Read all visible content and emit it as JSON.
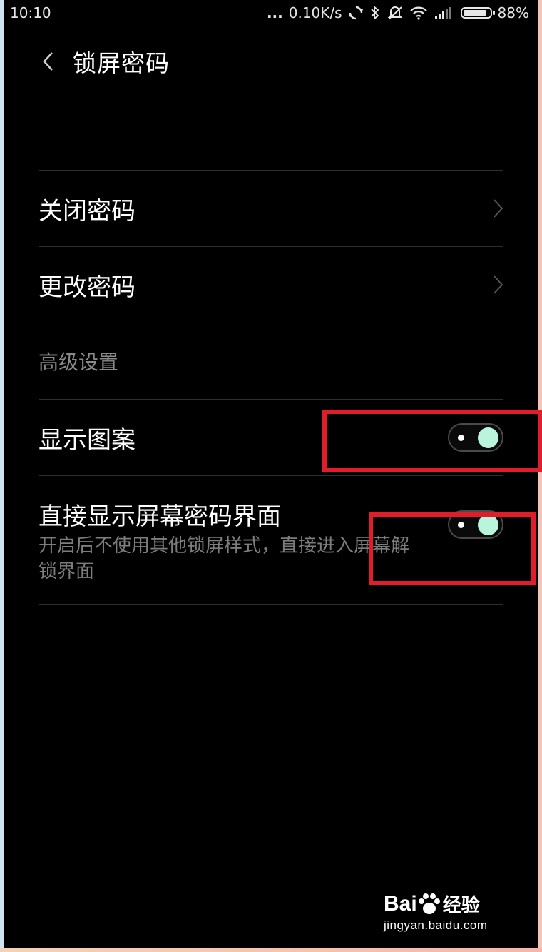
{
  "status_bar": {
    "time": "10:10",
    "dots": "...",
    "net_speed": "0.10K/s",
    "battery": "88%",
    "battery_level": 0.88,
    "icons": [
      "sync-icon",
      "bluetooth-icon",
      "mute-vibrate-icon",
      "wifi-icon",
      "signal-icon",
      "battery-icon"
    ]
  },
  "header": {
    "title": "锁屏密码",
    "back_icon": "chevron-left-icon"
  },
  "items": {
    "close_password": {
      "label": "关闭密码"
    },
    "change_password": {
      "label": "更改密码"
    }
  },
  "advanced": {
    "section_title": "高级设置",
    "show_pattern": {
      "label": "显示图案",
      "enabled": true
    },
    "direct_show": {
      "label": "直接显示屏幕密码界面",
      "description": "开启后不使用其他锁屏样式，直接进入屏幕解锁界面",
      "enabled": true
    }
  },
  "watermark": {
    "brand": "Bai",
    "brand_suffix": "经验",
    "url": "jingyan.baidu.com"
  },
  "colors": {
    "background": "#000000",
    "toggle_on": "#b9f4dc",
    "annotation": "#e01e2b"
  }
}
